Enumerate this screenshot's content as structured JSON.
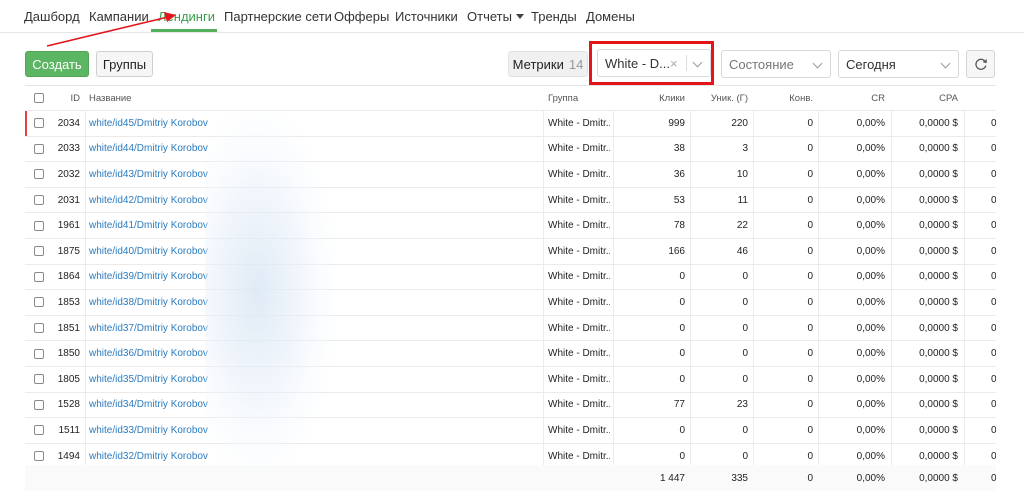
{
  "nav": {
    "items": [
      "Дашборд",
      "Кампании",
      "Лендинги",
      "Партнерские сети",
      "Офферы",
      "Источники",
      "Отчеты",
      "Тренды",
      "Домены"
    ],
    "active": "Лендинги"
  },
  "toolbar": {
    "create_label": "Создать",
    "groups_label": "Группы",
    "metrics_label": "Метрики",
    "metrics_count": "14",
    "group_filter_value": "White - D...",
    "group_filter_clear": "×",
    "state_placeholder": "Состояние",
    "date_value": "Сегодня",
    "refresh_icon": "refresh-icon"
  },
  "table": {
    "headers": {
      "id": "ID",
      "name": "Название",
      "group": "Группа",
      "clicks": "Клики",
      "unique": "Уник. (Г)",
      "conv": "Конв.",
      "cr": "CR",
      "cpa": "CPA"
    },
    "rows": [
      {
        "id": "2034",
        "name": "white/id45/Dmitriy Korobov",
        "group": "White - Dmitr...",
        "clicks": "999",
        "unique": "220",
        "conv": "0",
        "cr": "0,00%",
        "cpa": "0,0000 $",
        "extra": "0"
      },
      {
        "id": "2033",
        "name": "white/id44/Dmitriy Korobov",
        "group": "White - Dmitr...",
        "clicks": "38",
        "unique": "3",
        "conv": "0",
        "cr": "0,00%",
        "cpa": "0,0000 $",
        "extra": "0"
      },
      {
        "id": "2032",
        "name": "white/id43/Dmitriy Korobov",
        "group": "White - Dmitr...",
        "clicks": "36",
        "unique": "10",
        "conv": "0",
        "cr": "0,00%",
        "cpa": "0,0000 $",
        "extra": "0"
      },
      {
        "id": "2031",
        "name": "white/id42/Dmitriy Korobov",
        "group": "White - Dmitr...",
        "clicks": "53",
        "unique": "11",
        "conv": "0",
        "cr": "0,00%",
        "cpa": "0,0000 $",
        "extra": "0"
      },
      {
        "id": "1961",
        "name": "white/id41/Dmitriy Korobov",
        "group": "White - Dmitr...",
        "clicks": "78",
        "unique": "22",
        "conv": "0",
        "cr": "0,00%",
        "cpa": "0,0000 $",
        "extra": "0"
      },
      {
        "id": "1875",
        "name": "white/id40/Dmitriy Korobov",
        "group": "White - Dmitr...",
        "clicks": "166",
        "unique": "46",
        "conv": "0",
        "cr": "0,00%",
        "cpa": "0,0000 $",
        "extra": "0"
      },
      {
        "id": "1864",
        "name": "white/id39/Dmitriy Korobov",
        "group": "White - Dmitr...",
        "clicks": "0",
        "unique": "0",
        "conv": "0",
        "cr": "0,00%",
        "cpa": "0,0000 $",
        "extra": "0"
      },
      {
        "id": "1853",
        "name": "white/id38/Dmitriy Korobov",
        "group": "White - Dmitr...",
        "clicks": "0",
        "unique": "0",
        "conv": "0",
        "cr": "0,00%",
        "cpa": "0,0000 $",
        "extra": "0"
      },
      {
        "id": "1851",
        "name": "white/id37/Dmitriy Korobov",
        "group": "White - Dmitr...",
        "clicks": "0",
        "unique": "0",
        "conv": "0",
        "cr": "0,00%",
        "cpa": "0,0000 $",
        "extra": "0"
      },
      {
        "id": "1850",
        "name": "white/id36/Dmitriy Korobov",
        "group": "White - Dmitr...",
        "clicks": "0",
        "unique": "0",
        "conv": "0",
        "cr": "0,00%",
        "cpa": "0,0000 $",
        "extra": "0"
      },
      {
        "id": "1805",
        "name": "white/id35/Dmitriy Korobov",
        "group": "White - Dmitr...",
        "clicks": "0",
        "unique": "0",
        "conv": "0",
        "cr": "0,00%",
        "cpa": "0,0000 $",
        "extra": "0"
      },
      {
        "id": "1528",
        "name": "white/id34/Dmitriy Korobov",
        "group": "White - Dmitr...",
        "clicks": "77",
        "unique": "23",
        "conv": "0",
        "cr": "0,00%",
        "cpa": "0,0000 $",
        "extra": "0"
      },
      {
        "id": "1511",
        "name": "white/id33/Dmitriy Korobov",
        "group": "White - Dmitr...",
        "clicks": "0",
        "unique": "0",
        "conv": "0",
        "cr": "0,00%",
        "cpa": "0,0000 $",
        "extra": "0"
      },
      {
        "id": "1494",
        "name": "white/id32/Dmitriy Korobov",
        "group": "White - Dmitr...",
        "clicks": "0",
        "unique": "0",
        "conv": "0",
        "cr": "0,00%",
        "cpa": "0,0000 $",
        "extra": "0"
      }
    ],
    "totals": {
      "clicks": "1 447",
      "unique": "335",
      "conv": "0",
      "cr": "0,00%",
      "cpa": "0,0000 $",
      "extra": "0"
    }
  },
  "colors": {
    "accent_green": "#5cb562",
    "link_blue": "#2a7bbf",
    "annotation_red": "#e3151a"
  }
}
